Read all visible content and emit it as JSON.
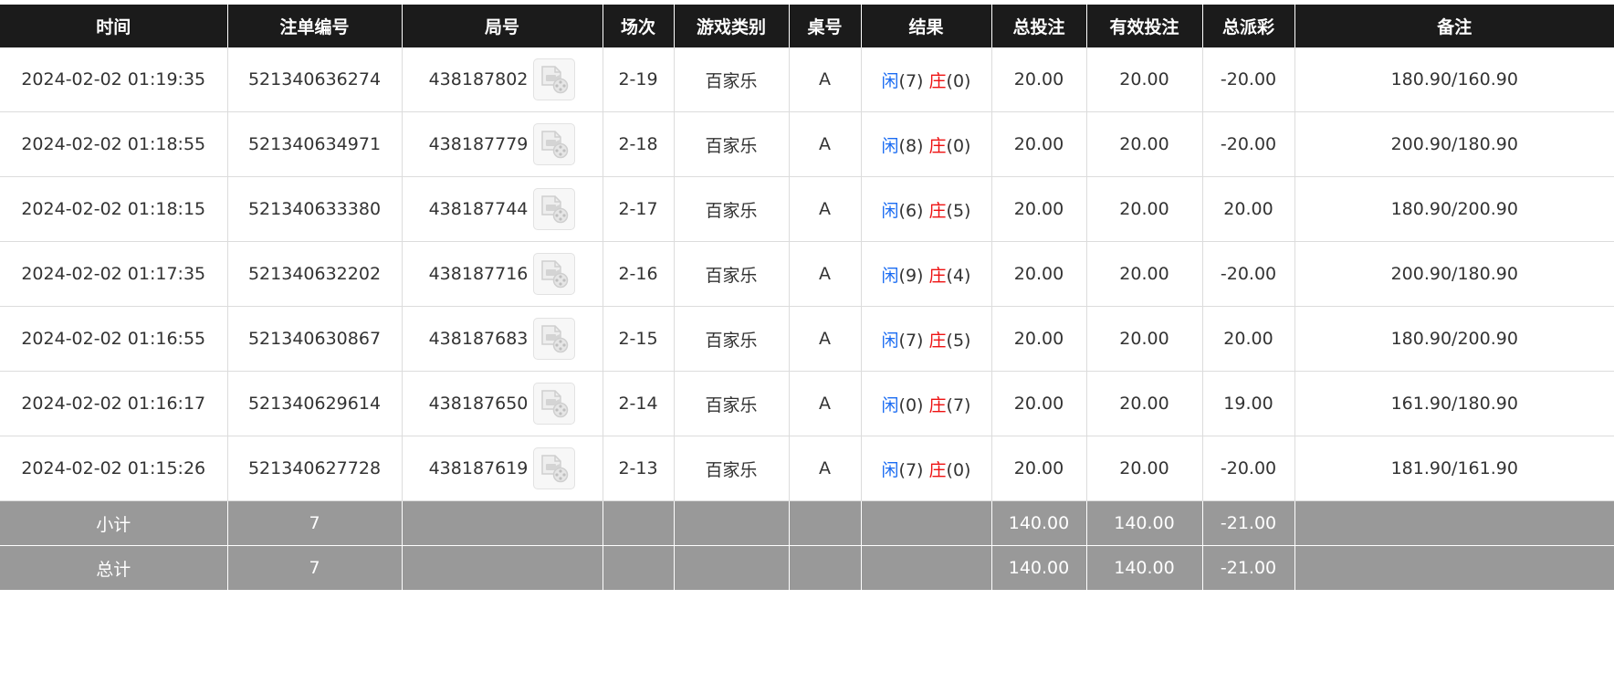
{
  "headers": {
    "time": "时间",
    "order_no": "注单编号",
    "round_no": "局号",
    "session": "场次",
    "game_type": "游戏类别",
    "table_no": "桌号",
    "result": "结果",
    "total_bet": "总投注",
    "valid_bet": "有效投注",
    "total_payout": "总派彩",
    "remark": "备注"
  },
  "rows": [
    {
      "time": "2024-02-02 01:19:35",
      "order_no": "521340636274",
      "round_no": "438187802",
      "session": "2-19",
      "game_type": "百家乐",
      "table_no": "A",
      "player_label": "闲",
      "player_score": "(7)",
      "banker_label": "庄",
      "banker_score": "(0)",
      "total_bet": "20.00",
      "valid_bet": "20.00",
      "total_payout": "-20.00",
      "remark": "180.90/160.90"
    },
    {
      "time": "2024-02-02 01:18:55",
      "order_no": "521340634971",
      "round_no": "438187779",
      "session": "2-18",
      "game_type": "百家乐",
      "table_no": "A",
      "player_label": "闲",
      "player_score": "(8)",
      "banker_label": "庄",
      "banker_score": "(0)",
      "total_bet": "20.00",
      "valid_bet": "20.00",
      "total_payout": "-20.00",
      "remark": "200.90/180.90"
    },
    {
      "time": "2024-02-02 01:18:15",
      "order_no": "521340633380",
      "round_no": "438187744",
      "session": "2-17",
      "game_type": "百家乐",
      "table_no": "A",
      "player_label": "闲",
      "player_score": "(6)",
      "banker_label": "庄",
      "banker_score": "(5)",
      "total_bet": "20.00",
      "valid_bet": "20.00",
      "total_payout": "20.00",
      "remark": "180.90/200.90"
    },
    {
      "time": "2024-02-02 01:17:35",
      "order_no": "521340632202",
      "round_no": "438187716",
      "session": "2-16",
      "game_type": "百家乐",
      "table_no": "A",
      "player_label": "闲",
      "player_score": "(9)",
      "banker_label": "庄",
      "banker_score": "(4)",
      "total_bet": "20.00",
      "valid_bet": "20.00",
      "total_payout": "-20.00",
      "remark": "200.90/180.90"
    },
    {
      "time": "2024-02-02 01:16:55",
      "order_no": "521340630867",
      "round_no": "438187683",
      "session": "2-15",
      "game_type": "百家乐",
      "table_no": "A",
      "player_label": "闲",
      "player_score": "(7)",
      "banker_label": "庄",
      "banker_score": "(5)",
      "total_bet": "20.00",
      "valid_bet": "20.00",
      "total_payout": "20.00",
      "remark": "180.90/200.90"
    },
    {
      "time": "2024-02-02 01:16:17",
      "order_no": "521340629614",
      "round_no": "438187650",
      "session": "2-14",
      "game_type": "百家乐",
      "table_no": "A",
      "player_label": "闲",
      "player_score": "(0)",
      "banker_label": "庄",
      "banker_score": "(7)",
      "total_bet": "20.00",
      "valid_bet": "20.00",
      "total_payout": "19.00",
      "remark": "161.90/180.90"
    },
    {
      "time": "2024-02-02 01:15:26",
      "order_no": "521340627728",
      "round_no": "438187619",
      "session": "2-13",
      "game_type": "百家乐",
      "table_no": "A",
      "player_label": "闲",
      "player_score": "(7)",
      "banker_label": "庄",
      "banker_score": "(0)",
      "total_bet": "20.00",
      "valid_bet": "20.00",
      "total_payout": "-20.00",
      "remark": "181.90/161.90"
    }
  ],
  "subtotal": {
    "label": "小计",
    "count": "7",
    "total_bet": "140.00",
    "valid_bet": "140.00",
    "total_payout": "-21.00"
  },
  "grand_total": {
    "label": "总计",
    "count": "7",
    "total_bet": "140.00",
    "valid_bet": "140.00",
    "total_payout": "-21.00"
  },
  "icons": {
    "replay": "video-replay-icon"
  },
  "colors": {
    "header_bg": "#1b1b1b",
    "player": "#1b6cf2",
    "banker": "#ee1111",
    "negative": "#ee1111",
    "summary_bg": "#999999"
  }
}
